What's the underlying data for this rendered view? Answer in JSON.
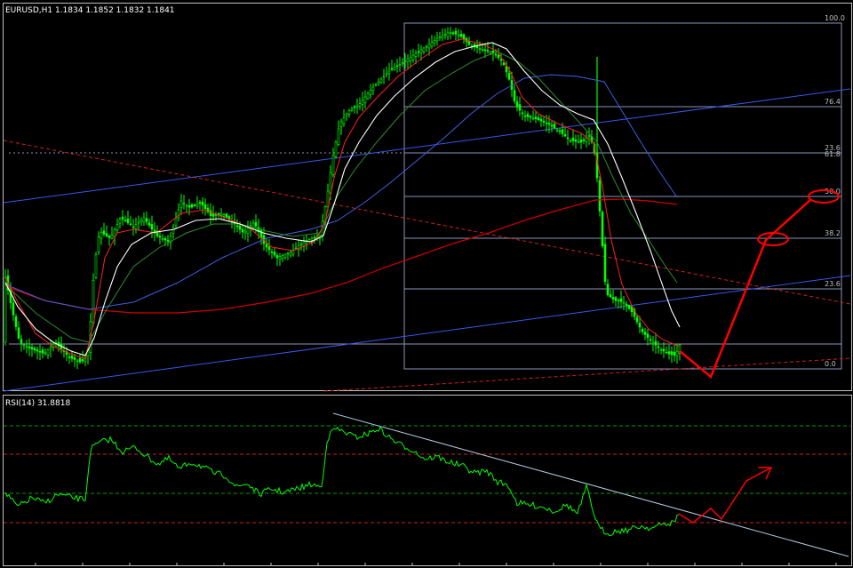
{
  "header": {
    "main_label": "EURUSD,H1  1.1834 1.1852 1.1832 1.1841",
    "rsi_label": "RSI(14)  31.8818"
  },
  "colors": {
    "background": "#000000",
    "frame": "#c0c0c0",
    "candle": "#00ff00",
    "fib": "#8a93b8",
    "ma_white": "#ffffff",
    "ma_red_short": "#ff2020",
    "ma_green": "#2e8b2e",
    "ma_blue": "#3f5fe0",
    "ma_red_long": "#d00000",
    "trend_blue": "#3858e8",
    "trend_red_dash": "#d02020",
    "rsi_line": "#00ff00",
    "rsi_level_green": "#00a000",
    "rsi_level_red": "#d02020",
    "rsi_trend": "#b0c8e0",
    "annotation": "#ff0000"
  },
  "chart_data": [
    {
      "type": "candlestick",
      "symbol": "EURUSD",
      "timeframe": "H1",
      "ohlc": [
        1.1834,
        1.1852,
        1.1832,
        1.1841
      ],
      "fib_levels": [
        "100.0",
        "76.4",
        "61.8",
        "50.0",
        "38.2",
        "23.6",
        "0.0"
      ],
      "fib_extra_label": "23.6"
    },
    {
      "type": "line",
      "name": "RSI(14)",
      "last_value": 31.8818
    }
  ]
}
